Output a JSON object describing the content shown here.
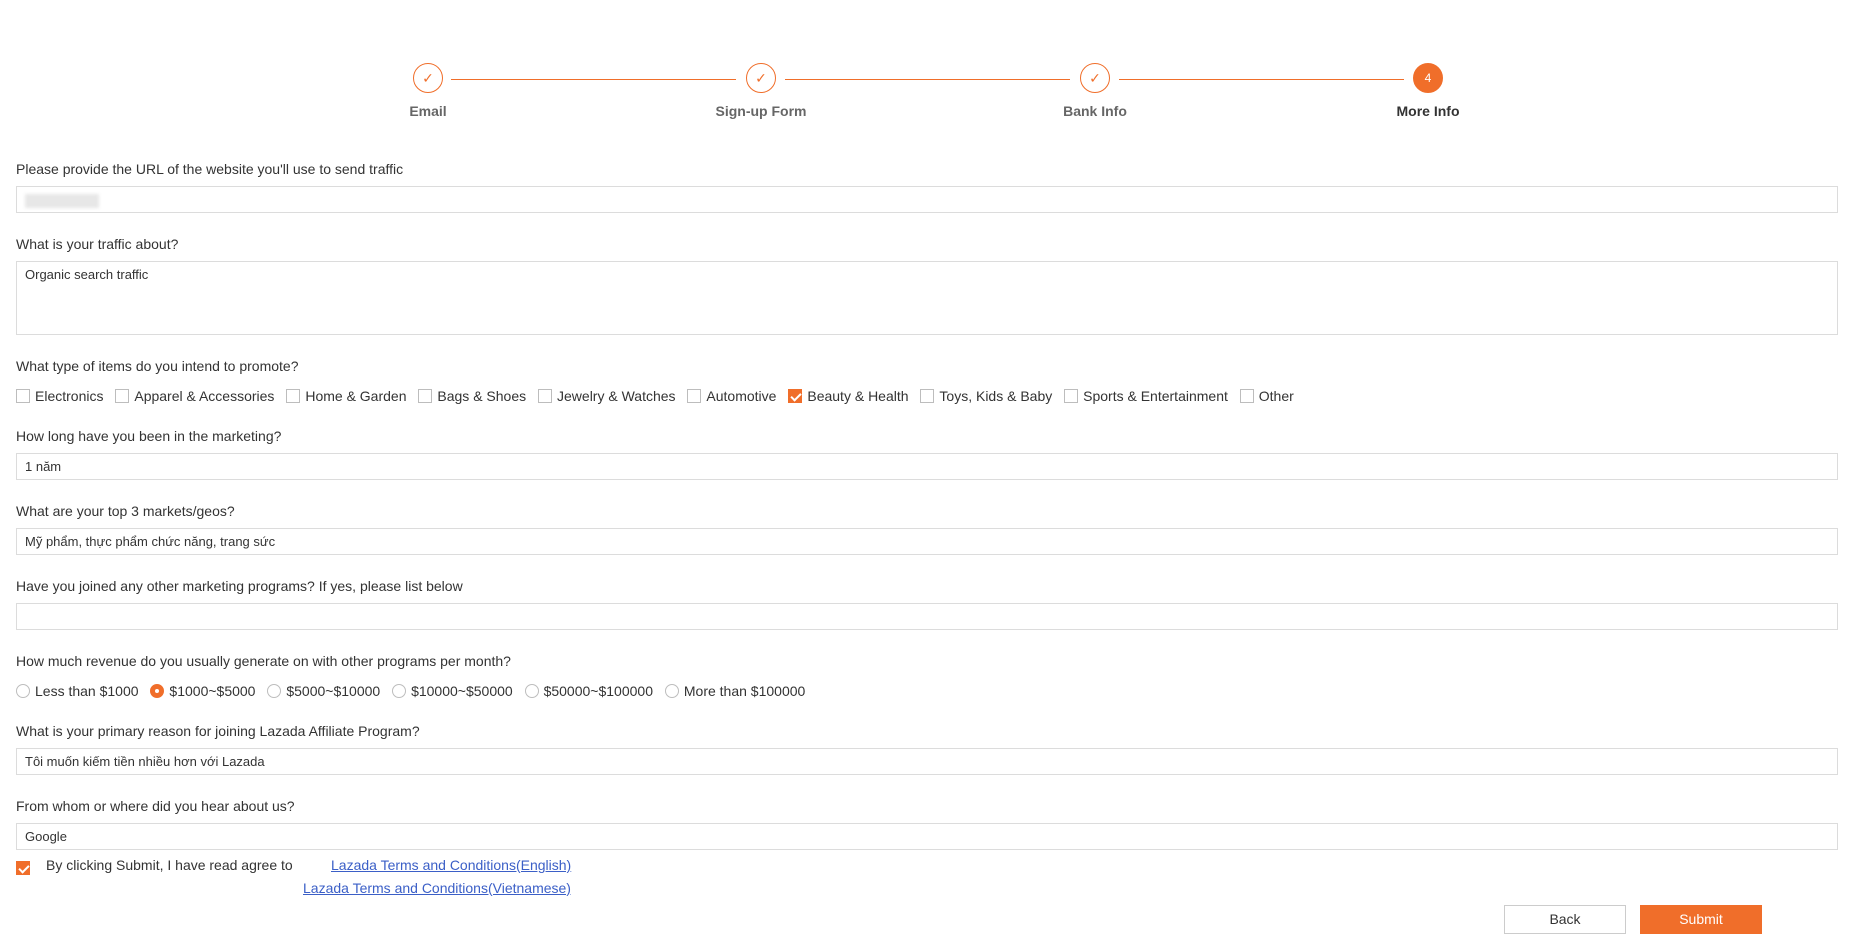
{
  "stepper": {
    "steps": [
      {
        "label": "Email",
        "state": "done"
      },
      {
        "label": "Sign-up Form",
        "state": "done"
      },
      {
        "label": "Bank Info",
        "state": "done"
      },
      {
        "label": "More Info",
        "state": "current",
        "number": "4"
      }
    ],
    "accent_color": "#f06e2a"
  },
  "form": {
    "website": {
      "label": "Please provide the URL of the website you'll use to send traffic",
      "value": ""
    },
    "traffic": {
      "label": "What is your traffic about?",
      "value": "Organic search traffic"
    },
    "item_types": {
      "label": "What type of items do you intend to promote?",
      "options": [
        {
          "label": "Electronics",
          "checked": false
        },
        {
          "label": "Apparel & Accessories",
          "checked": false
        },
        {
          "label": "Home & Garden",
          "checked": false
        },
        {
          "label": "Bags & Shoes",
          "checked": false
        },
        {
          "label": "Jewelry & Watches",
          "checked": false
        },
        {
          "label": "Automotive",
          "checked": false
        },
        {
          "label": "Beauty & Health",
          "checked": true
        },
        {
          "label": "Toys, Kids & Baby",
          "checked": false
        },
        {
          "label": "Sports & Entertainment",
          "checked": false
        },
        {
          "label": "Other",
          "checked": false
        }
      ]
    },
    "experience": {
      "label": "How long have you been in the marketing?",
      "value": "1 năm"
    },
    "markets": {
      "label": "What are your top 3 markets/geos?",
      "value": "Mỹ phẩm, thực phẩm chức năng, trang sức"
    },
    "other_programs": {
      "label": "Have you joined any other marketing programs? If yes, please list below",
      "value": ""
    },
    "revenue": {
      "label": "How much revenue do you usually generate on with other programs per month?",
      "options": [
        {
          "label": "Less than $1000",
          "checked": false
        },
        {
          "label": "$1000~$5000",
          "checked": true
        },
        {
          "label": "$5000~$10000",
          "checked": false
        },
        {
          "label": "$10000~$50000",
          "checked": false
        },
        {
          "label": "$50000~$100000",
          "checked": false
        },
        {
          "label": "More than $100000",
          "checked": false
        }
      ]
    },
    "reason": {
      "label": "What is your primary reason for joining Lazada Affiliate Program?",
      "value": "Tôi muốn kiếm tiền nhiều hơn với Lazada"
    },
    "source": {
      "label": "From whom or where did you hear about us?",
      "value": "Google"
    }
  },
  "agreement": {
    "checked": true,
    "text": "By clicking Submit, I have read agree to",
    "link_en": "Lazada Terms and Conditions(English)",
    "link_vi": "Lazada Terms and Conditions(Vietnamese)"
  },
  "buttons": {
    "back": "Back",
    "submit": "Submit"
  }
}
